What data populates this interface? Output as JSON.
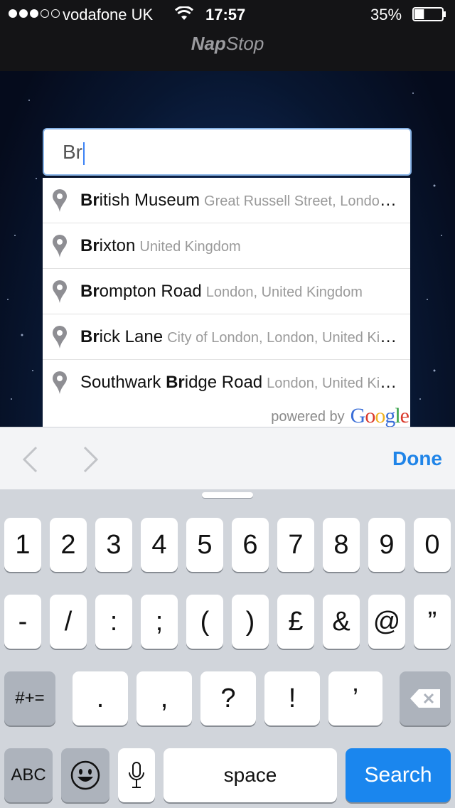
{
  "status_bar": {
    "carrier": "vodafone UK",
    "time": "17:57",
    "battery_percent": "35%",
    "battery_level": 0.35,
    "signal_bars": 3,
    "signal_total": 5
  },
  "app": {
    "title_bold": "Nap",
    "title_rest": "Stop"
  },
  "search": {
    "value": "Br"
  },
  "suggestions": [
    {
      "pre": "",
      "match": "Br",
      "post": "itish Museum",
      "secondary": "Great Russell Street, London, United Kingdom"
    },
    {
      "pre": "",
      "match": "Br",
      "post": "ixton",
      "secondary": "United Kingdom"
    },
    {
      "pre": "",
      "match": "Br",
      "post": "ompton Road",
      "secondary": "London, United Kingdom"
    },
    {
      "pre": "",
      "match": "Br",
      "post": "ick Lane",
      "secondary": "City of London, London, United Kingdom"
    },
    {
      "pre": "Southwark ",
      "match": "Br",
      "post": "idge Road",
      "secondary": "London, United Kingdom"
    }
  ],
  "attribution": {
    "powered_by": "powered by",
    "logo_letters": [
      "G",
      "o",
      "o",
      "g",
      "l",
      "e"
    ]
  },
  "toolbar": {
    "done_label": "Done"
  },
  "keyboard": {
    "row1": [
      "1",
      "2",
      "3",
      "4",
      "5",
      "6",
      "7",
      "8",
      "9",
      "0"
    ],
    "row2": [
      "-",
      "/",
      ":",
      ";",
      "(",
      ")",
      "£",
      "&",
      "@",
      "”"
    ],
    "row3": [
      ".",
      ",",
      "?",
      "!",
      "’"
    ],
    "symbols_label": "#+=",
    "abc_label": "ABC",
    "space_label": "space",
    "search_label": "Search"
  },
  "colors": {
    "accent": "#1f84e8",
    "search_key": "#1a86ee",
    "google": [
      "#3b6fd8",
      "#d9382a",
      "#f0b220",
      "#3b6fd8",
      "#2f9e41",
      "#d9382a"
    ]
  }
}
